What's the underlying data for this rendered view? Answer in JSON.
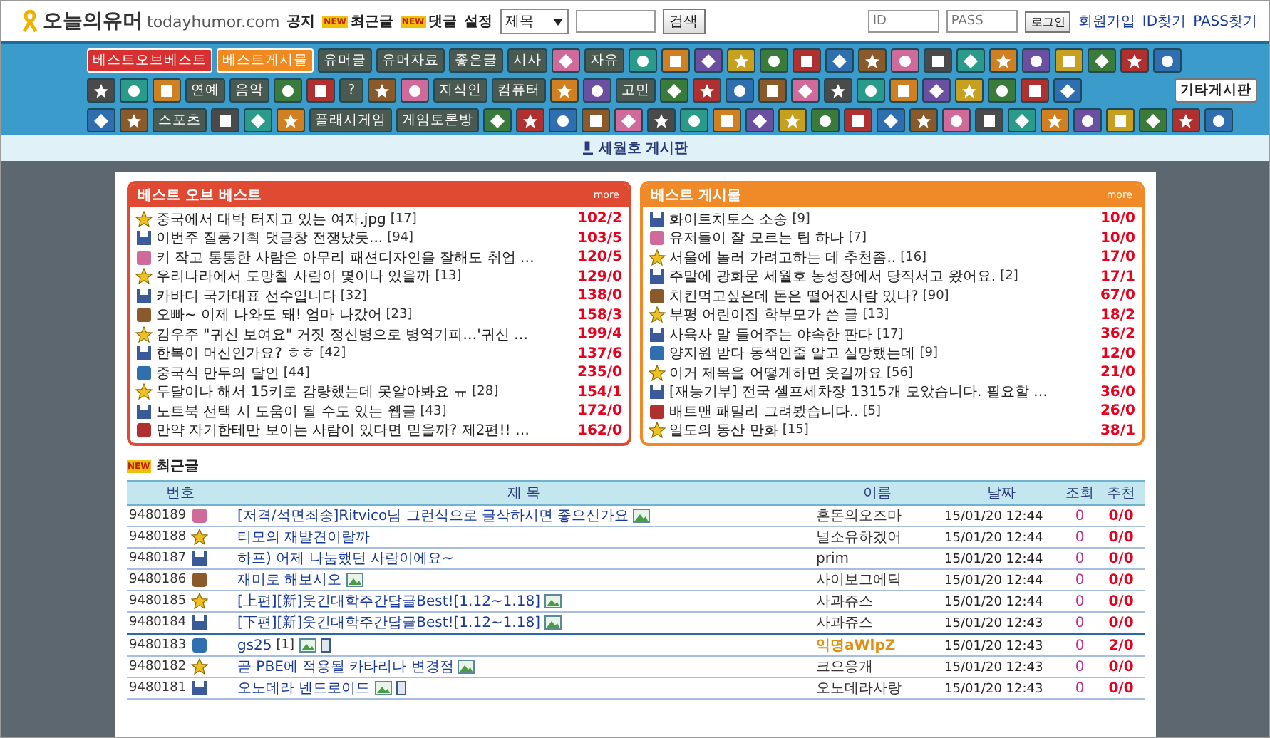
{
  "header": {
    "logo": "오늘의유머",
    "domain": "todayhumor.com",
    "links": [
      {
        "label": "공지"
      },
      {
        "label": "최근글",
        "badge": "NEW"
      },
      {
        "label": "댓글",
        "badge": "NEW"
      },
      {
        "label": "설정"
      }
    ],
    "search": {
      "scope": "제목",
      "button": "검색"
    },
    "login": {
      "id_placeholder": "ID",
      "pass_placeholder": "PASS",
      "button": "로그인"
    },
    "account_links": [
      "회원가입",
      "ID찾기",
      "PASS찾기"
    ]
  },
  "nav_rows": [
    [
      {
        "kind": "primary",
        "label": "베스트오브베스트"
      },
      {
        "kind": "secondary",
        "label": "베스트게시물"
      },
      {
        "kind": "label",
        "label": "유머글"
      },
      {
        "kind": "label",
        "label": "유머자료"
      },
      {
        "kind": "label",
        "label": "좋은글"
      },
      {
        "kind": "label",
        "label": "시사"
      },
      {
        "kind": "icon"
      },
      {
        "kind": "label",
        "label": "자유"
      },
      {
        "kind": "icon"
      },
      {
        "kind": "icon"
      },
      {
        "kind": "icon"
      },
      {
        "kind": "icon"
      },
      {
        "kind": "icon"
      },
      {
        "kind": "icon"
      },
      {
        "kind": "icon"
      },
      {
        "kind": "icon"
      },
      {
        "kind": "icon"
      },
      {
        "kind": "icon"
      },
      {
        "kind": "icon"
      },
      {
        "kind": "icon"
      },
      {
        "kind": "icon"
      },
      {
        "kind": "icon"
      },
      {
        "kind": "icon"
      },
      {
        "kind": "icon"
      },
      {
        "kind": "icon"
      }
    ],
    [
      {
        "kind": "icon"
      },
      {
        "kind": "icon"
      },
      {
        "kind": "icon"
      },
      {
        "kind": "label",
        "label": "연예"
      },
      {
        "kind": "label",
        "label": "음악"
      },
      {
        "kind": "icon"
      },
      {
        "kind": "icon"
      },
      {
        "kind": "label",
        "label": "?"
      },
      {
        "kind": "icon"
      },
      {
        "kind": "icon"
      },
      {
        "kind": "label",
        "label": "지식인"
      },
      {
        "kind": "label",
        "label": "컴퓨터"
      },
      {
        "kind": "icon"
      },
      {
        "kind": "icon"
      },
      {
        "kind": "label",
        "label": "고민"
      },
      {
        "kind": "icon"
      },
      {
        "kind": "icon"
      },
      {
        "kind": "icon"
      },
      {
        "kind": "icon"
      },
      {
        "kind": "icon"
      },
      {
        "kind": "icon"
      },
      {
        "kind": "icon"
      },
      {
        "kind": "icon"
      },
      {
        "kind": "icon"
      },
      {
        "kind": "icon"
      },
      {
        "kind": "icon"
      },
      {
        "kind": "icon"
      },
      {
        "kind": "icon"
      },
      {
        "kind": "white",
        "label": "기타게시판"
      }
    ],
    [
      {
        "kind": "icon"
      },
      {
        "kind": "icon"
      },
      {
        "kind": "label",
        "label": "스포츠"
      },
      {
        "kind": "icon"
      },
      {
        "kind": "icon"
      },
      {
        "kind": "icon"
      },
      {
        "kind": "label",
        "label": "플래시게임"
      },
      {
        "kind": "label",
        "label": "게임토론방"
      },
      {
        "kind": "icon"
      },
      {
        "kind": "icon"
      },
      {
        "kind": "icon"
      },
      {
        "kind": "icon"
      },
      {
        "kind": "icon"
      },
      {
        "kind": "icon"
      },
      {
        "kind": "icon"
      },
      {
        "kind": "icon"
      },
      {
        "kind": "icon"
      },
      {
        "kind": "icon"
      },
      {
        "kind": "icon"
      },
      {
        "kind": "icon"
      },
      {
        "kind": "icon"
      },
      {
        "kind": "icon"
      },
      {
        "kind": "icon"
      },
      {
        "kind": "icon"
      },
      {
        "kind": "icon"
      },
      {
        "kind": "icon"
      },
      {
        "kind": "icon"
      },
      {
        "kind": "icon"
      },
      {
        "kind": "icon"
      },
      {
        "kind": "icon"
      },
      {
        "kind": "icon"
      }
    ]
  ],
  "notice_board": "세월호 게시판",
  "panels": [
    {
      "title": "베스트 오브 베스트",
      "more": "more",
      "kind": "red",
      "items": [
        {
          "title": "중국에서 대박 터지고 있는 여자.jpg",
          "comments": "[17]",
          "score": "102/2"
        },
        {
          "title": "이번주 질풍기획 댓글창 전쟁났듯...",
          "comments": "[94]",
          "score": "103/5"
        },
        {
          "title": "키 작고 통통한 사람은 아무리 패션디자인을 잘해도 취업 …",
          "score": "120/5"
        },
        {
          "title": "우리나라에서 도망칠 사람이 몇이나 있을까",
          "comments": "[13]",
          "score": "129/0"
        },
        {
          "title": "카바디 국가대표 선수입니다",
          "comments": "[32]",
          "score": "138/0"
        },
        {
          "title": "오빠~ 이제 나와도 돼! 엄마 나갔어",
          "comments": "[23]",
          "score": "158/3"
        },
        {
          "title": "김우주 \"귀신 보여요\" 거짓 정신병으로 병역기피…'귀신 …",
          "score": "199/4"
        },
        {
          "title": "한복이 머신인가요? ㅎㅎ",
          "comments": "[42]",
          "score": "137/6"
        },
        {
          "title": "중국식 만두의 달인",
          "comments": "[44]",
          "score": "235/0"
        },
        {
          "title": "두달이나 해서 15키로 감량했는데 못알아봐요 ㅠ",
          "comments": "[28]",
          "score": "154/1"
        },
        {
          "title": "노트북 선택 시 도움이 될 수도 있는 웹글",
          "comments": "[43]",
          "score": "172/0"
        },
        {
          "title": "만약 자기한테만 보이는 사람이 있다면 믿을까? 제2편!! …",
          "score": "162/0"
        }
      ]
    },
    {
      "title": "베스트 게시물",
      "more": "more",
      "kind": "orange",
      "items": [
        {
          "title": "화이트치토스 소송",
          "comments": "[9]",
          "score": "10/0"
        },
        {
          "title": "유저들이 잘 모르는 팁 하나",
          "comments": "[7]",
          "score": "10/0"
        },
        {
          "title": "서울에 놀러 가려고하는 데 추천좀..",
          "comments": "[16]",
          "score": "17/0"
        },
        {
          "title": "주말에 광화문 세월호 농성장에서 당직서고 왔어요.",
          "comments": "[2]",
          "score": "17/1"
        },
        {
          "title": "치킨먹고싶은데 돈은 떨어진사람 있나?",
          "comments": "[90]",
          "score": "67/0"
        },
        {
          "title": "부평 어린이집 학부모가 쓴 글",
          "comments": "[13]",
          "score": "18/2"
        },
        {
          "title": "사육사 말 들어주는 야속한 판다",
          "comments": "[17]",
          "score": "36/2"
        },
        {
          "title": "양지원 받다 동색인줄 알고 실망했는데",
          "comments": "[9]",
          "score": "12/0"
        },
        {
          "title": "이거 제목을 어떻게하면 웃길까요",
          "comments": "[56]",
          "score": "21/0"
        },
        {
          "title": "[재능기부] 전국 셀프세차장 1315개 모았습니다. 필요할 …",
          "score": "36/0"
        },
        {
          "title": "배트맨 패밀리 그려봤습니다..",
          "comments": "[5]",
          "score": "26/0"
        },
        {
          "title": "일도의 동산 만화",
          "comments": "[15]",
          "score": "38/1"
        }
      ]
    }
  ],
  "recent": {
    "badge": "NEW",
    "title": "최근글",
    "columns": [
      "번호",
      "제 목",
      "이름",
      "날짜",
      "조회",
      "추천"
    ],
    "rows": [
      {
        "num": "9480189",
        "title": "[저격/석면죄송]Ritvico님 그런식으로 글삭하시면 좋으신가요",
        "has_image": true,
        "has_file": false,
        "name": "혼돈의오즈마",
        "anonymous": false,
        "date": "15/01/20 12:44",
        "views": "0",
        "votes": "0/0",
        "separator": false
      },
      {
        "num": "9480188",
        "title": "티모의 재발견이랄까",
        "has_image": false,
        "has_file": false,
        "name": "널소유하겠어",
        "anonymous": false,
        "date": "15/01/20 12:44",
        "views": "0",
        "votes": "0/0",
        "separator": false
      },
      {
        "num": "9480187",
        "title": "하프) 어제 나눔했던 사람이에요~",
        "has_image": false,
        "has_file": false,
        "name": "prim",
        "anonymous": false,
        "date": "15/01/20 12:44",
        "views": "0",
        "votes": "0/0",
        "separator": false
      },
      {
        "num": "9480186",
        "title": "재미로 해보시오",
        "has_image": true,
        "has_file": false,
        "name": "사이보그에딕",
        "anonymous": false,
        "date": "15/01/20 12:44",
        "views": "0",
        "votes": "0/0",
        "separator": false
      },
      {
        "num": "9480185",
        "title": "[上편][新]웃긴대학주간답글Best![1.12~1.18]",
        "has_image": true,
        "has_file": false,
        "name": "사과쥬스",
        "anonymous": false,
        "date": "15/01/20 12:44",
        "views": "0",
        "votes": "0/0",
        "separator": false
      },
      {
        "num": "9480184",
        "title": "[下편][新]웃긴대학주간답글Best![1.12~1.18]",
        "has_image": true,
        "has_file": false,
        "name": "사과쥬스",
        "anonymous": false,
        "date": "15/01/20 12:43",
        "views": "0",
        "votes": "0/0",
        "separator": false
      },
      {
        "num": "9480183",
        "title": "gs25",
        "comments": "[1]",
        "has_image": true,
        "has_file": true,
        "name": "익명aWlpZ",
        "anonymous": true,
        "date": "15/01/20 12:43",
        "views": "0",
        "votes": "2/0",
        "separator": true
      },
      {
        "num": "9480182",
        "title": "곧 PBE에 적용될 카타리나 변경점",
        "has_image": true,
        "has_file": false,
        "name": "크으응개",
        "anonymous": false,
        "date": "15/01/20 12:43",
        "views": "0",
        "votes": "0/0",
        "separator": false
      },
      {
        "num": "9480181",
        "title": "오노데라 넨드로이드",
        "has_image": true,
        "has_file": true,
        "name": "오노데라사랑",
        "anonymous": false,
        "date": "15/01/20 12:43",
        "views": "0",
        "votes": "0/0",
        "separator": false
      }
    ]
  }
}
